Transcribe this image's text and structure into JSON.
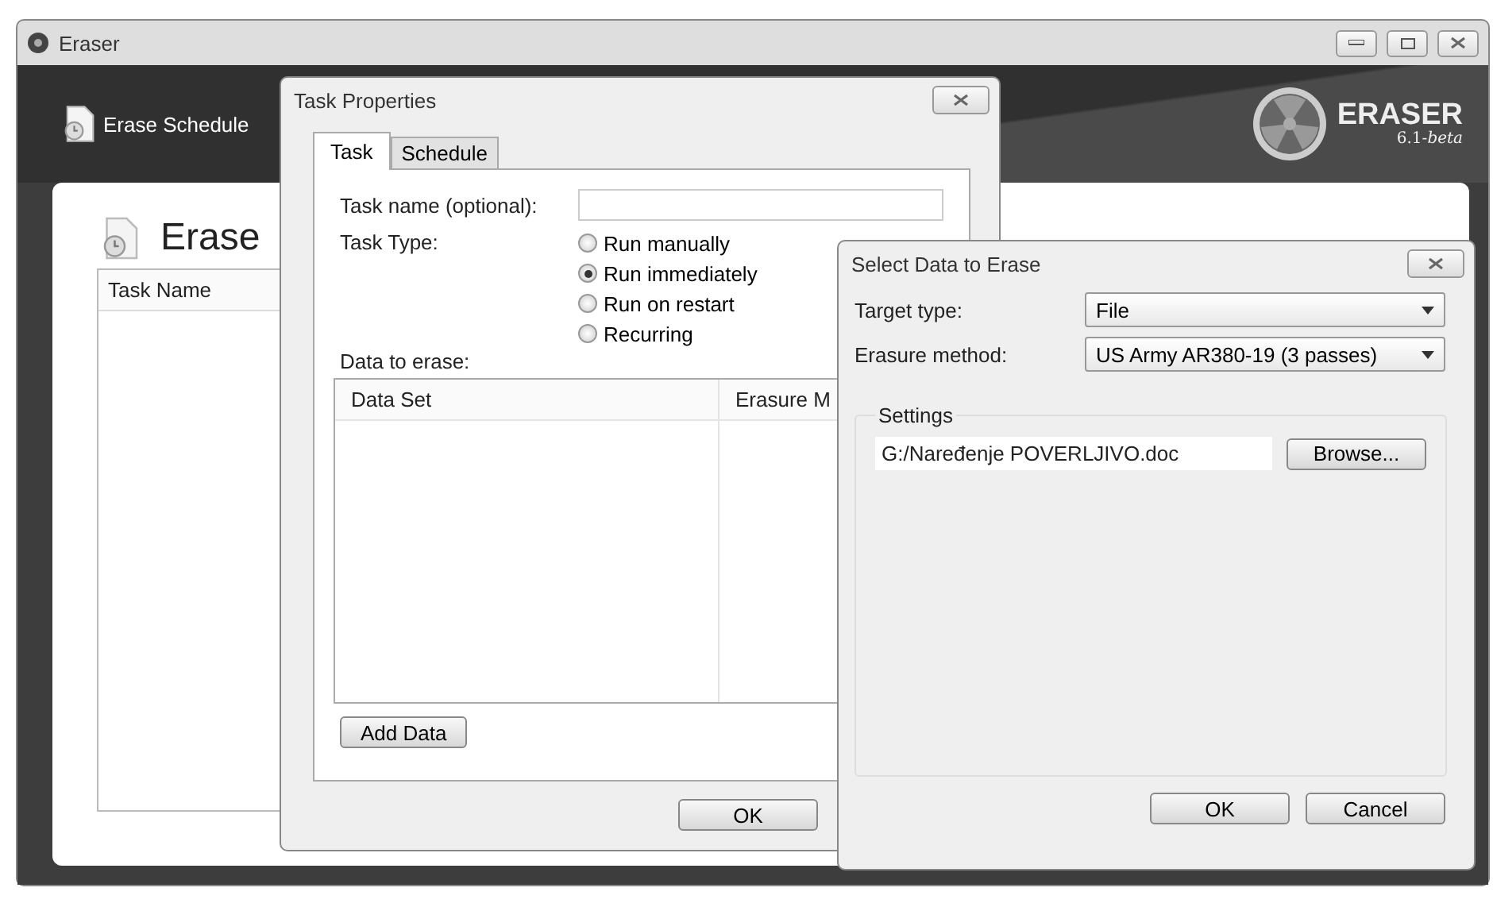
{
  "main_window": {
    "title": "Eraser",
    "sidebar_button": "Erase Schedule",
    "logo": {
      "name": "ERASER",
      "version": "6.1-*beta*"
    },
    "heading": "Erase",
    "columns": [
      "Task Name"
    ]
  },
  "task_properties": {
    "title": "Task Properties",
    "tabs": [
      {
        "label": "Task",
        "selected": true
      },
      {
        "label": "Schedule",
        "selected": false
      }
    ],
    "task_name": {
      "label": "Task name (optional):"
    },
    "task_type": {
      "label": "Task Type:",
      "options": [
        {
          "label": "Run manually",
          "selected": false
        },
        {
          "label": "Run immediately",
          "selected": true
        },
        {
          "label": "Run on restart",
          "selected": false
        },
        {
          "label": "Recurring",
          "selected": false
        }
      ]
    },
    "data_label": "Data to erase:",
    "columns": [
      "Data Set",
      "Erasure M"
    ],
    "add_button": "Add Data",
    "ok_button": "OK"
  },
  "select_data": {
    "title": "Select Data to Erase",
    "target_type": {
      "label": "Target type:",
      "value": "File"
    },
    "erasure_method": {
      "label": "Erasure method:",
      "value": "US Army AR380-19 (3 passes)"
    },
    "settings": {
      "legend": "Settings",
      "path": "G:/Naređenje POVERLJIVO.doc",
      "browse_button": "Browse..."
    },
    "buttons": [
      "OK",
      "Cancel"
    ]
  }
}
